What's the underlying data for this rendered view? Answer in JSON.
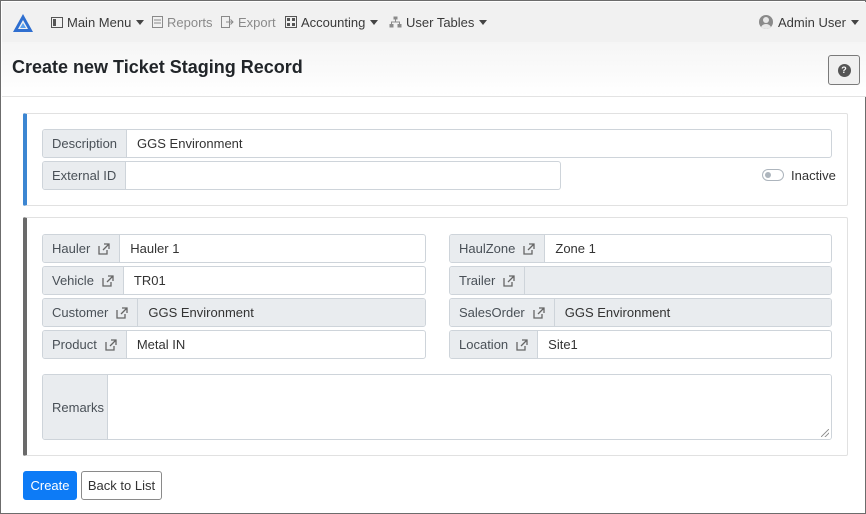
{
  "navbar": {
    "main_menu": "Main Menu",
    "reports": "Reports",
    "export": "Export",
    "accounting": "Accounting",
    "user_tables": "User Tables",
    "user": "Admin User"
  },
  "page": {
    "title": "Create new Ticket Staging Record",
    "help": "?"
  },
  "general": {
    "description_label": "Description",
    "description_value": "GGS Environment",
    "external_id_label": "External ID",
    "external_id_value": "",
    "inactive_label": "Inactive",
    "inactive_on": false
  },
  "details": {
    "hauler_label": "Hauler",
    "hauler_value": "Hauler 1",
    "vehicle_label": "Vehicle",
    "vehicle_value": "TR01",
    "customer_label": "Customer",
    "customer_value": "GGS Environment",
    "product_label": "Product",
    "product_value": "Metal IN",
    "haulzone_label": "HaulZone",
    "haulzone_value": "Zone 1",
    "trailer_label": "Trailer",
    "trailer_value": "",
    "salesorder_label": "SalesOrder",
    "salesorder_value": "GGS Environment",
    "location_label": "Location",
    "location_value": "Site1",
    "remarks_label": "Remarks",
    "remarks_value": ""
  },
  "actions": {
    "create": "Create",
    "back": "Back to List"
  },
  "colors": {
    "primary": "#0d7bf6",
    "accent_blue": "#3c86d2",
    "accent_gray": "#6a6a6a"
  }
}
